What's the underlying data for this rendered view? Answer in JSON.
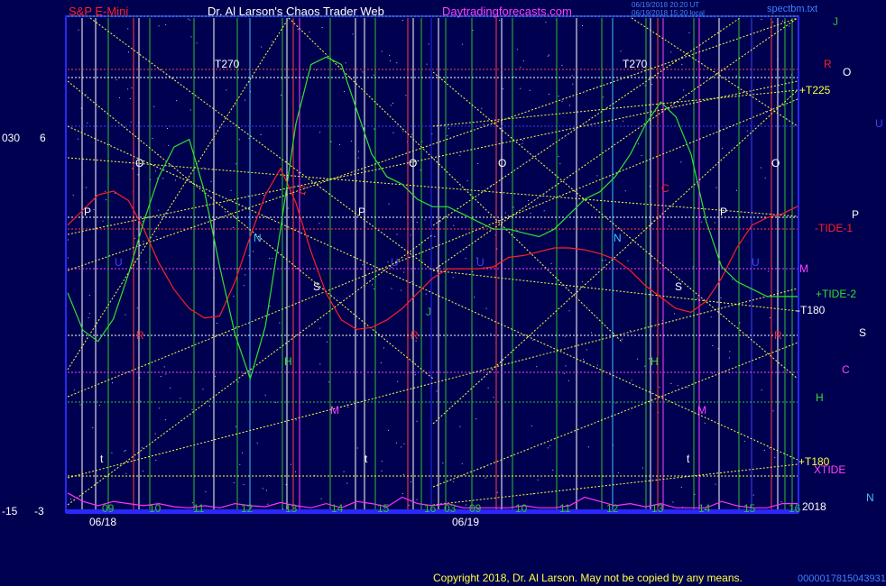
{
  "header": {
    "instrument": "S&P E-Mini",
    "title": "Dr. Al Larson's Chaos Trader Web",
    "site": "Daytradingforecasts.com",
    "ts1": "06/19/2018 20:20 UT",
    "ts2": "06/19/2018 15:20 local",
    "file": "spectbm.txt"
  },
  "footer": {
    "copyright": "Copyright 2018, Dr. Al Larson. May not be copied by any means.",
    "code": "0000017815043931"
  },
  "left_axis": {
    "a": "030",
    "b": "6",
    "c": "-15",
    "d": "-3"
  },
  "year": "2018",
  "dates": [
    "06/18",
    "06/19"
  ],
  "hour_labels": [
    "09",
    "10",
    "11",
    "12",
    "13",
    "14",
    "15",
    "16",
    "03",
    "09",
    "10",
    "11",
    "12",
    "13",
    "14",
    "15",
    "16"
  ],
  "right_labels": {
    "j": "J",
    "r": "R",
    "o": "O",
    "t225": "+T225",
    "u": "U",
    "p": "P",
    "tide1": "-TIDE-1",
    "m": "M",
    "tide2": "+TIDE-2",
    "t180a": "-T180",
    "s": "S",
    "c": "C",
    "h": "H",
    "t180b": "+T180",
    "xtide": "XTIDE",
    "n": "N"
  },
  "chart_labels": {
    "t270a": "T270",
    "t270b": "T270",
    "o1": "O",
    "o2": "O",
    "o3": "O",
    "o4": "O",
    "p1": "P",
    "p2": "P",
    "p3": "P",
    "n1": "N",
    "n2": "N",
    "c1": "C",
    "c2": "C",
    "s1": "S",
    "s2": "S",
    "h1": "H",
    "h2": "H",
    "m1": "M",
    "m2": "M",
    "r1": "R",
    "r2": "R",
    "r3": "R",
    "u1": "U",
    "u2": "U",
    "u3": "U",
    "u4": "U",
    "j1": "J",
    "t1": "t",
    "t2": "t",
    "t3": "t"
  },
  "colors": {
    "background": "#000050",
    "frame": "#2828ff",
    "red": "#ff2020",
    "green": "#30e030",
    "magenta": "#ff30ff",
    "yellow": "#ffff40",
    "white": "#ffffff",
    "cyan": "#40c0ff"
  },
  "chart_data": {
    "type": "line",
    "x": [
      0,
      0.5,
      1,
      1.5,
      2,
      2.5,
      3,
      3.5,
      4,
      4.5,
      5,
      5.5,
      6,
      6.5,
      7,
      7.5,
      8,
      8.5,
      9,
      9.5,
      10,
      10.5,
      11,
      11.5,
      12,
      12.5,
      13,
      13.5,
      14,
      14.5,
      15,
      15.5,
      16,
      16.5,
      17,
      17.5,
      18,
      18.5,
      19,
      19.5,
      20,
      20.5,
      21,
      21.5,
      22,
      22.5,
      23,
      23.5,
      24
    ],
    "series": [
      {
        "values": [
          62,
          70,
          78,
          80,
          75,
          60,
          42,
          28,
          18,
          13,
          14,
          32,
          56,
          78,
          92,
          74,
          48,
          26,
          12,
          7,
          8,
          12,
          18,
          26,
          34,
          39,
          39,
          39,
          40,
          45,
          46,
          48,
          50,
          50,
          49,
          47,
          44,
          38,
          30,
          24,
          18,
          16,
          22,
          34,
          50,
          62,
          66,
          68,
          72
        ]
      },
      {
        "values": [
          35,
          25,
          22,
          28,
          40,
          54,
          66,
          74,
          76,
          62,
          42,
          24,
          12,
          26,
          52,
          80,
          96,
          98,
          96,
          84,
          72,
          66,
          64,
          60,
          58,
          58,
          56,
          54,
          52,
          52,
          51,
          50,
          52,
          56,
          60,
          62,
          66,
          72,
          80,
          86,
          82,
          72,
          54,
          42,
          38,
          36,
          34,
          34,
          34
        ]
      },
      {
        "values": [
          18,
          10,
          6,
          10,
          8,
          6,
          8,
          5,
          4,
          6,
          4,
          8,
          6,
          5,
          9,
          6,
          4,
          8,
          4,
          10,
          8,
          5,
          14,
          8,
          6,
          8,
          4,
          4,
          4,
          4,
          6,
          4,
          4,
          6,
          14,
          10,
          6,
          8,
          5,
          8,
          4,
          4,
          4,
          10,
          6,
          4,
          4,
          8,
          8
        ]
      }
    ]
  }
}
